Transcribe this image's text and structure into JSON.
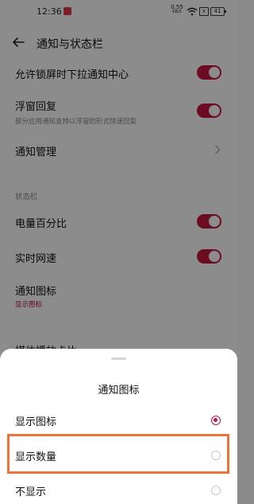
{
  "status_bar": {
    "time": "12:36",
    "net_speed_value": "0.55",
    "net_speed_unit": "KB/S",
    "sim_label": "x",
    "battery": "41",
    "icons": [
      "app-notification-icon",
      "wifi-icon",
      "sim-icon",
      "battery-icon"
    ]
  },
  "header": {
    "title": "通知与状态栏",
    "back_icon": "back-arrow-icon"
  },
  "settings": {
    "lock_pull_down": {
      "title": "允许锁屏时下拉通知中心",
      "enabled": true
    },
    "floating_reply": {
      "title": "浮窗回复",
      "subtitle": "部分应用通知支持以浮窗的形式快速回复",
      "enabled": true
    },
    "notification_manage": {
      "title": "通知管理"
    },
    "status_bar_section": "状态栏",
    "battery_percent": {
      "title": "电量百分比",
      "enabled": true
    },
    "realtime_speed": {
      "title": "实时网速",
      "enabled": true
    },
    "notification_icon": {
      "title": "通知图标",
      "value": "显示图标"
    },
    "media_card": {
      "title": "媒体播放卡片"
    }
  },
  "sheet": {
    "title": "通知图标",
    "options": [
      {
        "label": "显示图标",
        "selected": true
      },
      {
        "label": "显示数量",
        "selected": false
      },
      {
        "label": "不显示",
        "selected": false
      }
    ]
  },
  "colors": {
    "accent": "#c3173f",
    "highlight": "#f0713a"
  }
}
